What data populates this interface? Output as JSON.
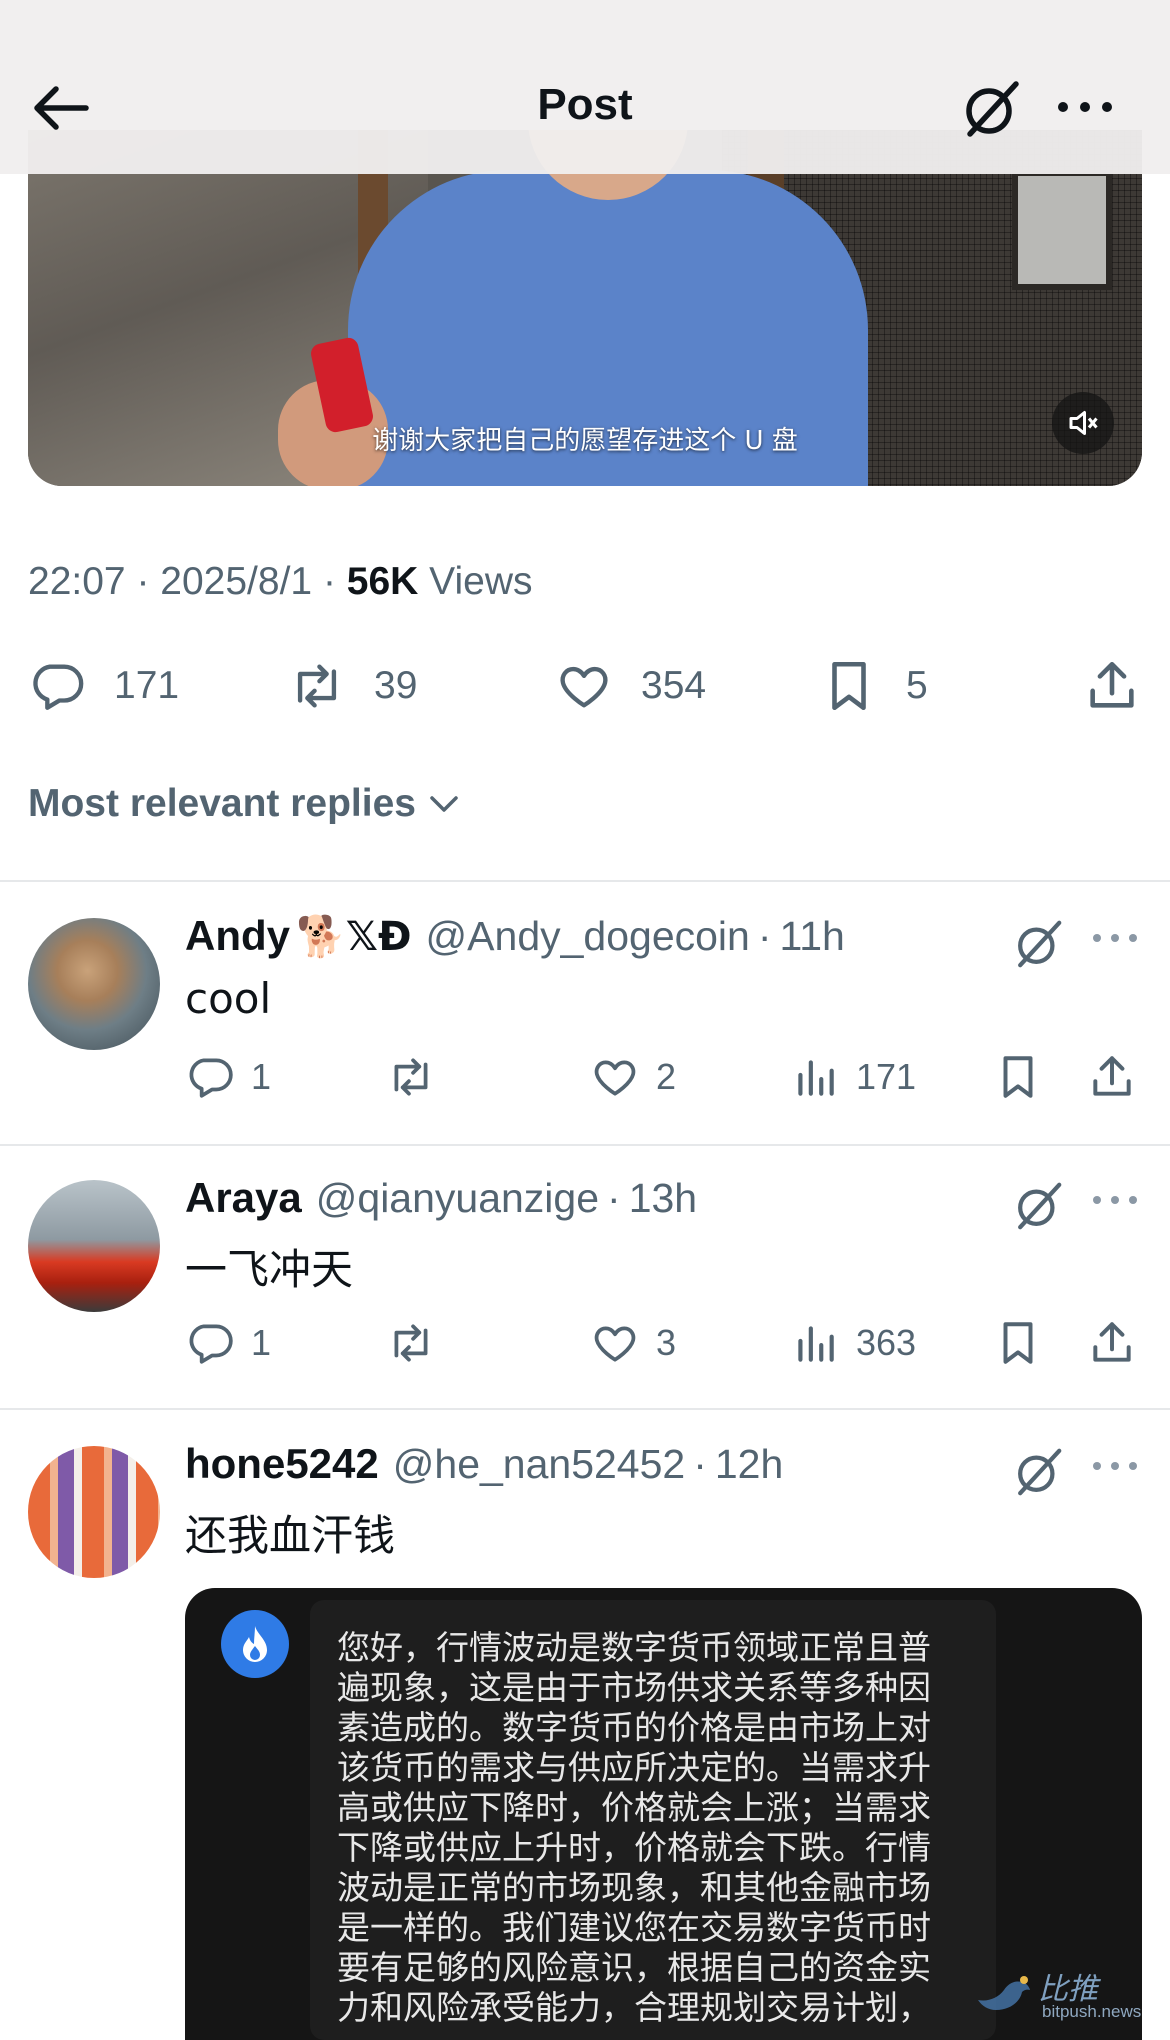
{
  "header": {
    "title": "Post"
  },
  "video": {
    "caption": "谢谢大家把自己的愿望存进这个 U 盘"
  },
  "post_meta": {
    "time": "22:07",
    "date": "2025/8/1",
    "views_count": "56K",
    "views_label": "Views"
  },
  "post_actions": {
    "replies": "171",
    "reposts": "39",
    "likes": "354",
    "bookmarks": "5"
  },
  "replies_filter": {
    "label": "Most relevant replies"
  },
  "replies": [
    {
      "name": "Andy",
      "name_suffix": "🐕𝕏Đ",
      "handle": "@Andy_dogecoin",
      "time": "11h",
      "text": "cool",
      "replies": "1",
      "reposts": "",
      "likes": "2",
      "views": "171"
    },
    {
      "name": "Araya",
      "name_suffix": "",
      "handle": "@qianyuanzige",
      "time": "13h",
      "text": "一飞冲天",
      "replies": "1",
      "reposts": "",
      "likes": "3",
      "views": "363"
    },
    {
      "name": "hone5242",
      "name_suffix": "",
      "handle": "@he_nan52452",
      "time": "12h",
      "text": "还我血汗钱"
    }
  ],
  "attached_image": {
    "lines": [
      "您好，行情波动是数字货币领域正常且普",
      "遍现象，这是由于市场供求关系等多种因",
      "素造成的。数字货币的价格是由市场上对",
      "该货币的需求与供应所决定的。当需求升",
      "高或供应下降时，价格就会上涨；当需求",
      "下降或供应上升时，价格就会下跌。行情",
      "波动是正常的市场现象，和其他金融市场",
      "是一样的。我们建议您在交易数字货币时",
      "要有足够的风险意识，根据自己的资金实",
      "力和风险承受能力，合理规划交易计划，"
    ]
  },
  "watermark": {
    "brand": "比推",
    "url": "bitpush.news"
  },
  "colors": {
    "text": "#0f1419",
    "secondary": "#536471",
    "divider": "#e6e8ea",
    "header_bg": "#f0eeee"
  }
}
